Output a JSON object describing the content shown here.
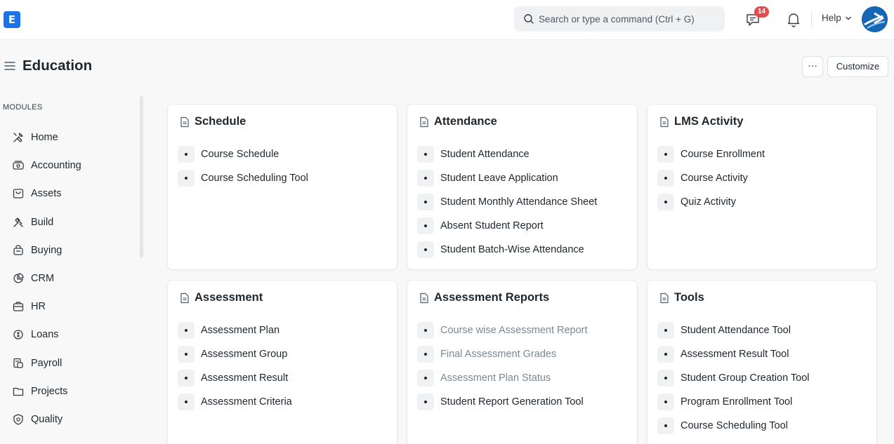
{
  "app": {
    "logo_letter": "E",
    "notification_count": "14",
    "help_label": "Help"
  },
  "search": {
    "placeholder": "Search or type a command (Ctrl + G)"
  },
  "page": {
    "title": "Education",
    "more_label": "···",
    "customize_label": "Customize"
  },
  "sidebar": {
    "section_label": "MODULES",
    "items": [
      {
        "label": "Home",
        "icon": "tools-icon"
      },
      {
        "label": "Accounting",
        "icon": "money-icon"
      },
      {
        "label": "Assets",
        "icon": "bag-icon"
      },
      {
        "label": "Build",
        "icon": "hammer-icon"
      },
      {
        "label": "Buying",
        "icon": "basket-icon"
      },
      {
        "label": "CRM",
        "icon": "chart-icon"
      },
      {
        "label": "HR",
        "icon": "briefcase-icon"
      },
      {
        "label": "Loans",
        "icon": "loan-icon"
      },
      {
        "label": "Payroll",
        "icon": "payroll-icon"
      },
      {
        "label": "Projects",
        "icon": "folder-icon"
      },
      {
        "label": "Quality",
        "icon": "shield-icon"
      }
    ]
  },
  "cards": [
    {
      "title": "Schedule",
      "links": [
        {
          "label": "Course Schedule",
          "dim": false
        },
        {
          "label": "Course Scheduling Tool",
          "dim": false
        }
      ]
    },
    {
      "title": "Attendance",
      "links": [
        {
          "label": "Student Attendance",
          "dim": false
        },
        {
          "label": "Student Leave Application",
          "dim": false
        },
        {
          "label": "Student Monthly Attendance Sheet",
          "dim": false
        },
        {
          "label": "Absent Student Report",
          "dim": false
        },
        {
          "label": "Student Batch-Wise Attendance",
          "dim": false
        }
      ]
    },
    {
      "title": "LMS Activity",
      "links": [
        {
          "label": "Course Enrollment",
          "dim": false
        },
        {
          "label": "Course Activity",
          "dim": false
        },
        {
          "label": "Quiz Activity",
          "dim": false
        }
      ]
    },
    {
      "title": "Assessment",
      "links": [
        {
          "label": "Assessment Plan",
          "dim": false
        },
        {
          "label": "Assessment Group",
          "dim": false
        },
        {
          "label": "Assessment Result",
          "dim": false
        },
        {
          "label": "Assessment Criteria",
          "dim": false
        }
      ]
    },
    {
      "title": "Assessment Reports",
      "links": [
        {
          "label": "Course wise Assessment Report",
          "dim": true
        },
        {
          "label": "Final Assessment Grades",
          "dim": true
        },
        {
          "label": "Assessment Plan Status",
          "dim": true
        },
        {
          "label": "Student Report Generation Tool",
          "dim": false
        }
      ]
    },
    {
      "title": "Tools",
      "links": [
        {
          "label": "Student Attendance Tool",
          "dim": false
        },
        {
          "label": "Assessment Result Tool",
          "dim": false
        },
        {
          "label": "Student Group Creation Tool",
          "dim": false
        },
        {
          "label": "Program Enrollment Tool",
          "dim": false
        },
        {
          "label": "Course Scheduling Tool",
          "dim": false
        }
      ]
    }
  ],
  "colors": {
    "brand": "#1a73e8",
    "badge": "#e24c4c",
    "dim_text": "#7c8891"
  }
}
